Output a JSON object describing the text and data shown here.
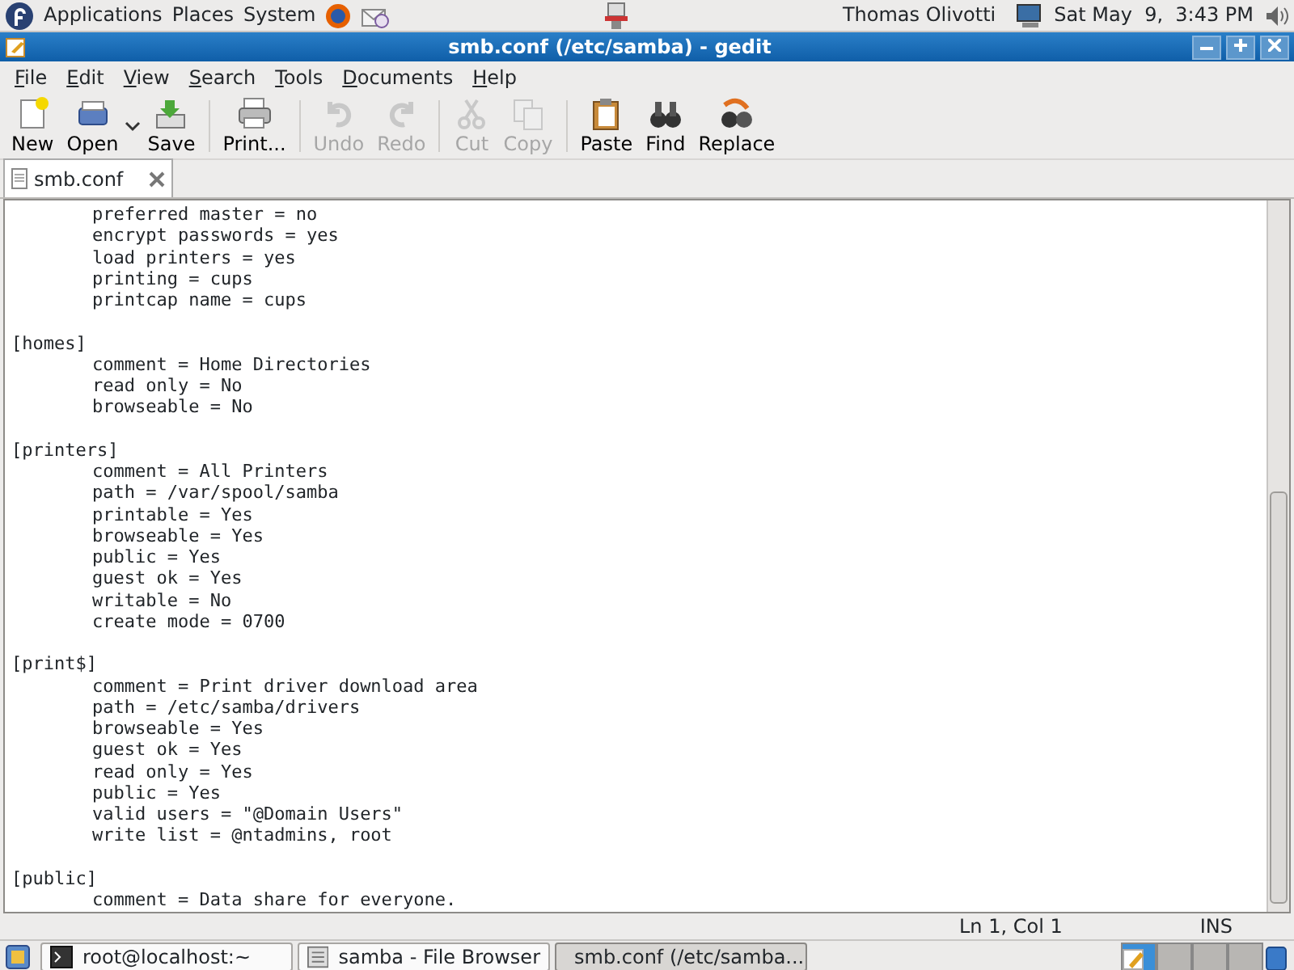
{
  "top_panel": {
    "menus": [
      "Applications",
      "Places",
      "System"
    ],
    "user": "Thomas Olivotti",
    "clock": "Sat May  9,  3:43 PM"
  },
  "window": {
    "title": "smb.conf (/etc/samba) - gedit"
  },
  "menu_bar": [
    "File",
    "Edit",
    "View",
    "Search",
    "Tools",
    "Documents",
    "Help"
  ],
  "toolbar": [
    {
      "label": "New",
      "kind": "new",
      "disabled": false
    },
    {
      "label": "Open",
      "kind": "open",
      "disabled": false
    },
    {
      "label": "Save",
      "kind": "save",
      "disabled": false
    },
    {
      "label": "Print...",
      "kind": "print",
      "disabled": false
    },
    {
      "label": "Undo",
      "kind": "undo",
      "disabled": true
    },
    {
      "label": "Redo",
      "kind": "redo",
      "disabled": true
    },
    {
      "label": "Cut",
      "kind": "cut",
      "disabled": true
    },
    {
      "label": "Copy",
      "kind": "copy",
      "disabled": true
    },
    {
      "label": "Paste",
      "kind": "paste",
      "disabled": false
    },
    {
      "label": "Find",
      "kind": "find",
      "disabled": false
    },
    {
      "label": "Replace",
      "kind": "replace",
      "disabled": false
    }
  ],
  "tabs": [
    {
      "label": "smb.conf",
      "selected": true
    }
  ],
  "editor": {
    "lines": [
      {
        "kind": "setting",
        "text": "preferred master = no"
      },
      {
        "kind": "setting",
        "text": "encrypt passwords = yes"
      },
      {
        "kind": "setting",
        "text": "load printers = yes"
      },
      {
        "kind": "setting",
        "text": "printing = cups"
      },
      {
        "kind": "setting",
        "text": "printcap name = cups"
      },
      {
        "kind": "blank"
      },
      {
        "kind": "section",
        "text": "[homes]"
      },
      {
        "kind": "setting",
        "text": "comment = Home Directories"
      },
      {
        "kind": "setting",
        "text": "read only = No"
      },
      {
        "kind": "setting",
        "text": "browseable = No"
      },
      {
        "kind": "blank"
      },
      {
        "kind": "section",
        "text": "[printers]"
      },
      {
        "kind": "setting",
        "text": "comment = All Printers"
      },
      {
        "kind": "setting",
        "text": "path = /var/spool/samba"
      },
      {
        "kind": "setting",
        "text": "printable = Yes"
      },
      {
        "kind": "setting",
        "text": "browseable = Yes"
      },
      {
        "kind": "setting",
        "text": "public = Yes"
      },
      {
        "kind": "setting",
        "text": "guest ok = Yes"
      },
      {
        "kind": "setting",
        "text": "writable = No"
      },
      {
        "kind": "setting",
        "text": "create mode = 0700"
      },
      {
        "kind": "blank"
      },
      {
        "kind": "section",
        "text": "[print$]"
      },
      {
        "kind": "setting",
        "text": "comment = Print driver download area"
      },
      {
        "kind": "setting",
        "text": "path = /etc/samba/drivers"
      },
      {
        "kind": "setting",
        "text": "browseable = Yes"
      },
      {
        "kind": "setting",
        "text": "guest ok = Yes"
      },
      {
        "kind": "setting",
        "text": "read only = Yes"
      },
      {
        "kind": "setting",
        "text": "public = Yes"
      },
      {
        "kind": "setting",
        "text": "valid users = \"@Domain Users\""
      },
      {
        "kind": "setting",
        "text": "write list = @ntadmins, root"
      },
      {
        "kind": "blank"
      },
      {
        "kind": "section",
        "text": "[public]"
      },
      {
        "kind": "setting",
        "text": "comment = Data share for everyone."
      }
    ]
  },
  "status_bar": {
    "position": "Ln 1, Col 1",
    "mode": "INS"
  },
  "taskbar": [
    {
      "label": "root@localhost:~",
      "kind": "terminal",
      "selected": false
    },
    {
      "label": "samba - File Browser",
      "kind": "folder",
      "selected": false
    },
    {
      "label": "smb.conf (/etc/samba...",
      "kind": "editor",
      "selected": true
    }
  ]
}
